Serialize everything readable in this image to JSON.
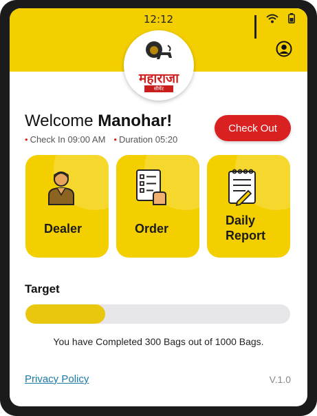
{
  "status_bar": {
    "time": "12:12"
  },
  "brand": {
    "logo_text": "महाराजा",
    "logo_subtext": "सीमेंट"
  },
  "welcome": {
    "greeting": "Welcome ",
    "name": "Manohar!"
  },
  "session": {
    "check_in": "Check In 09:00 AM",
    "duration": "Duration 05:20"
  },
  "actions": {
    "check_out_label": "Check Out"
  },
  "cards": [
    {
      "label": "Dealer",
      "icon": "dealer-person-icon"
    },
    {
      "label": "Order",
      "icon": "order-checklist-icon"
    },
    {
      "label": "Daily Report",
      "icon": "daily-report-notepad-icon"
    }
  ],
  "target": {
    "title": "Target",
    "completed": 300,
    "total": 1000,
    "message": "You have Completed 300 Bags out of 1000 Bags."
  },
  "footer": {
    "privacy_label": "Privacy Policy",
    "version": "V.1.0"
  },
  "colors": {
    "accent_yellow": "#f4cf00",
    "checkout_red": "#d92121",
    "link_blue": "#1a7aa6"
  }
}
